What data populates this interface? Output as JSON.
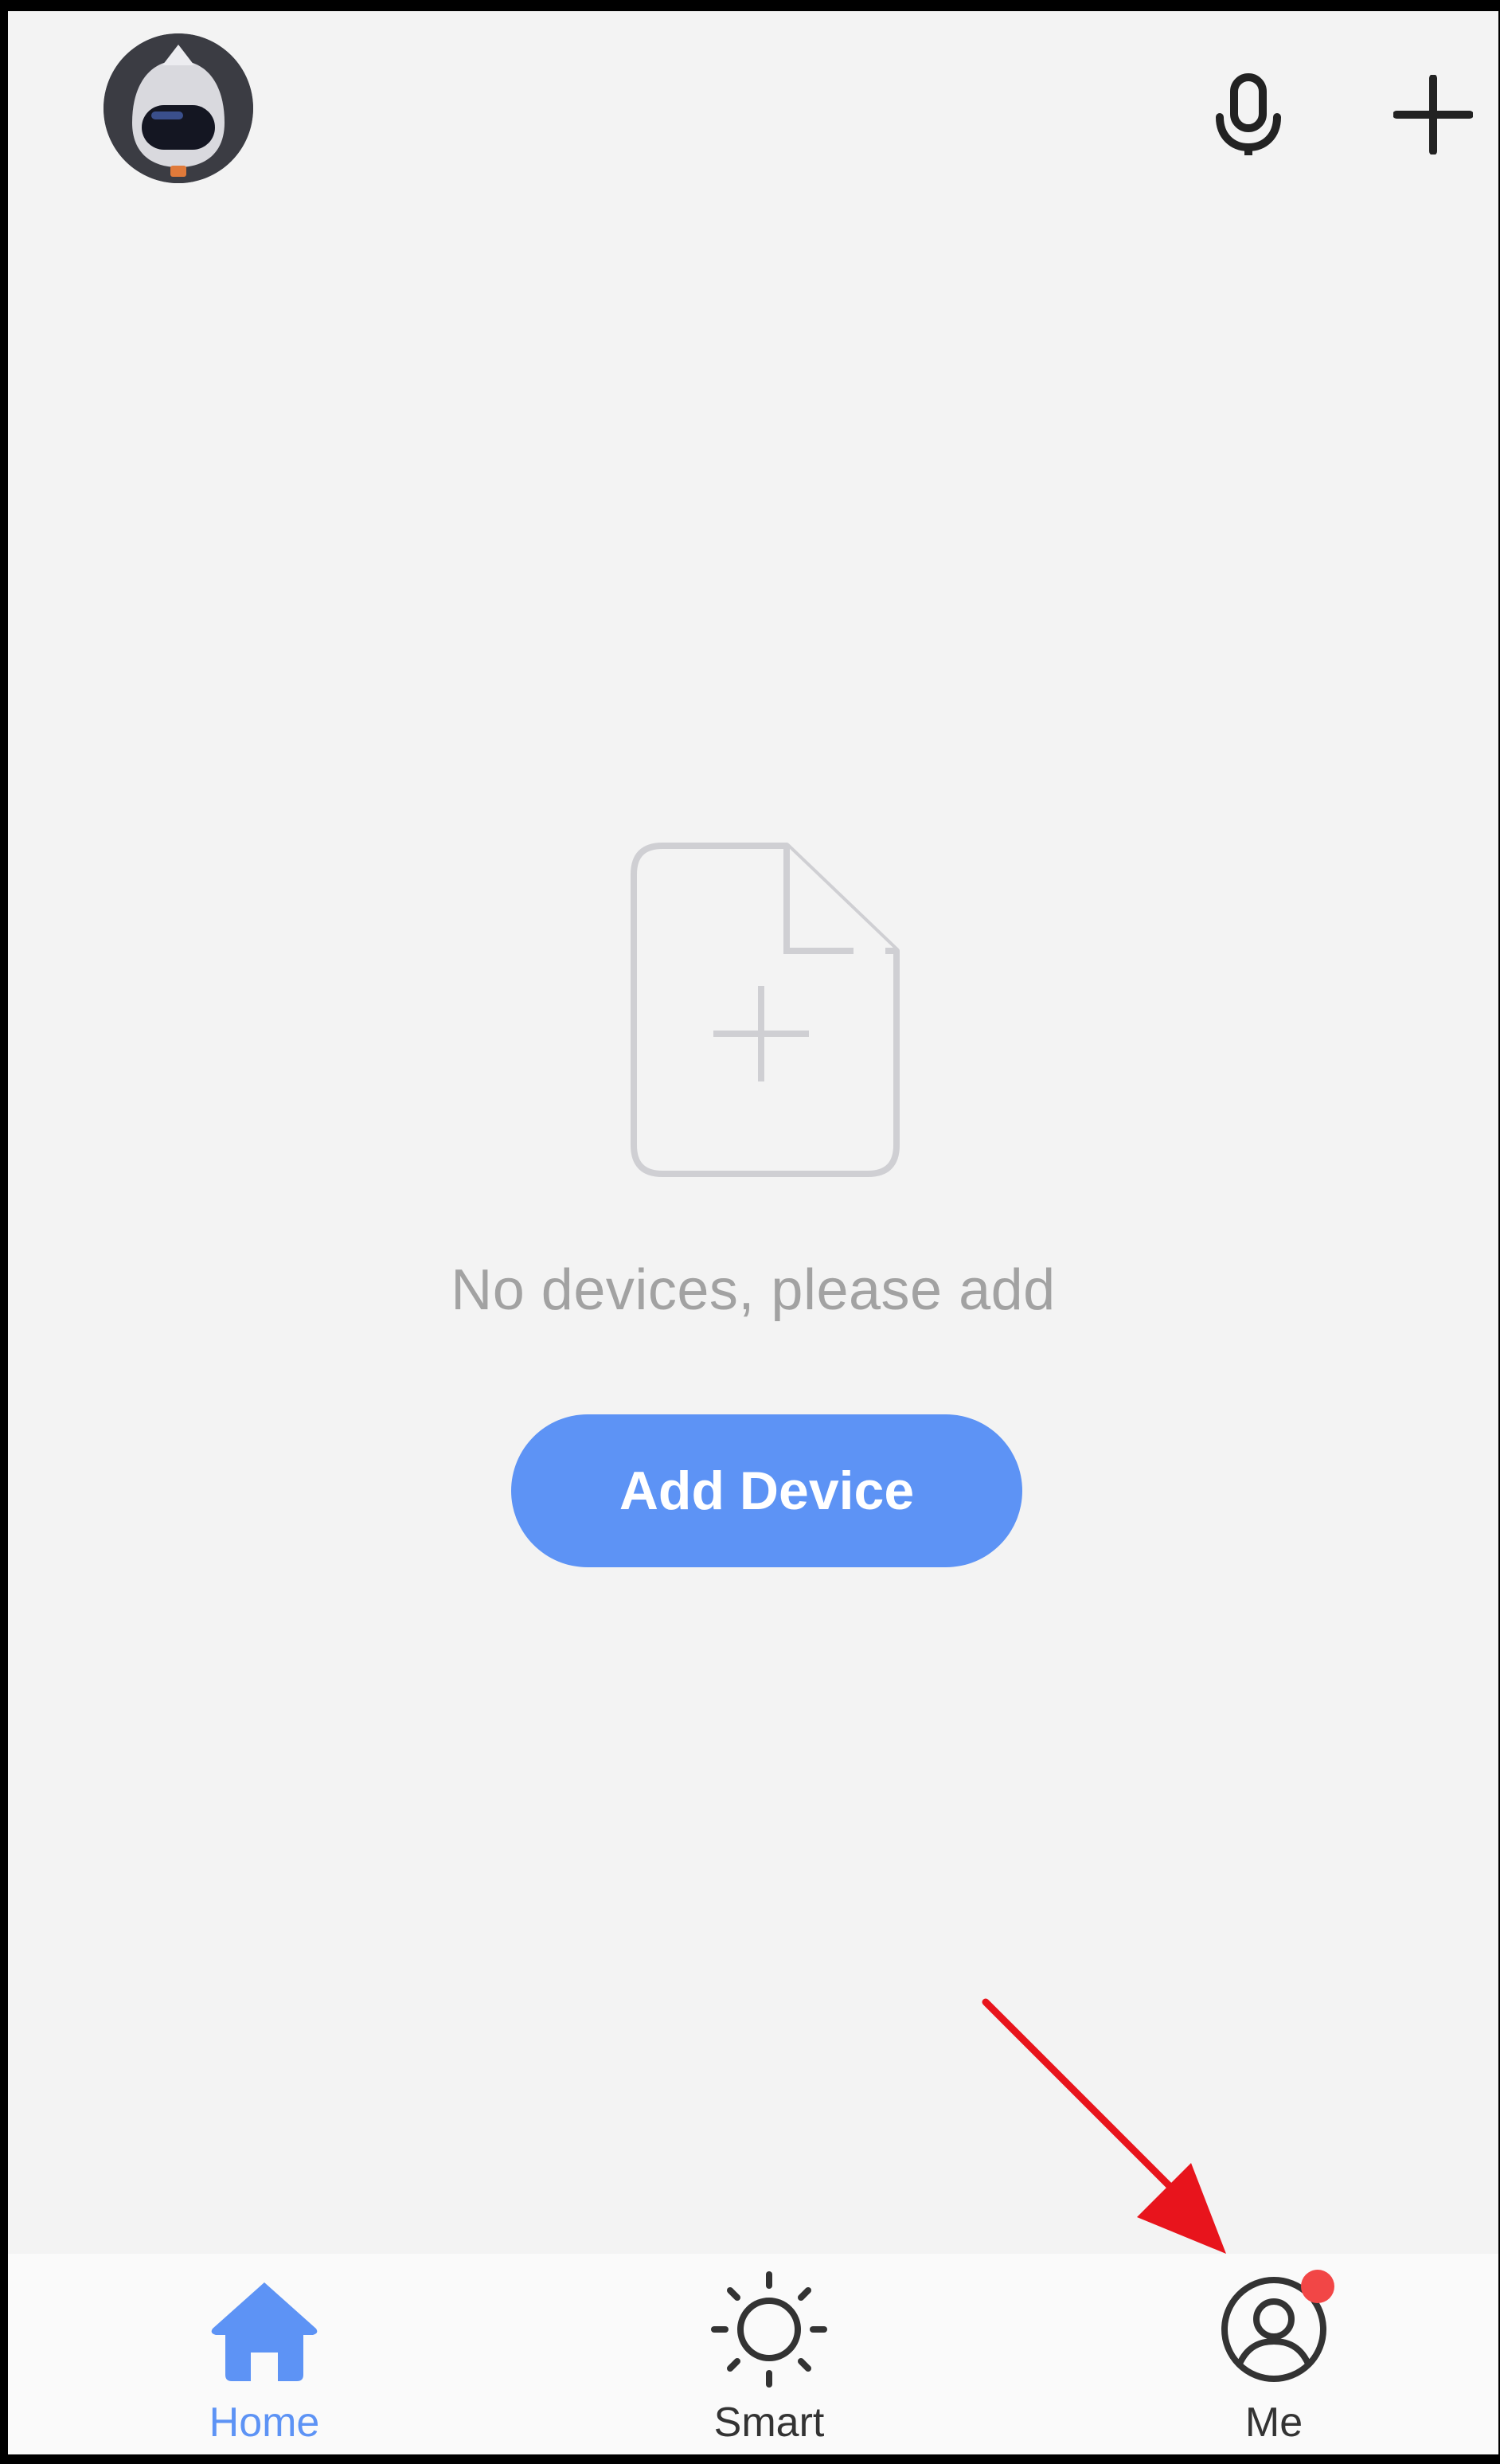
{
  "header": {
    "avatar_icon": "robot-avatar-icon",
    "voice_icon": "microphone-icon",
    "add_icon": "plus-icon"
  },
  "empty_state": {
    "icon": "add-file-icon",
    "message": "No devices, please add",
    "button_label": "Add Device"
  },
  "tabs": [
    {
      "label": "Home",
      "icon": "home-icon",
      "active": true
    },
    {
      "label": "Smart",
      "icon": "sun-icon",
      "active": false
    },
    {
      "label": "Me",
      "icon": "user-icon",
      "active": false,
      "has_badge": true
    }
  ],
  "colors": {
    "background": "#f3f3f3",
    "accent": "#5d93f5",
    "badge": "#f24646",
    "empty_text": "#a2a2a2",
    "annotation_arrow": "#e8141c"
  }
}
